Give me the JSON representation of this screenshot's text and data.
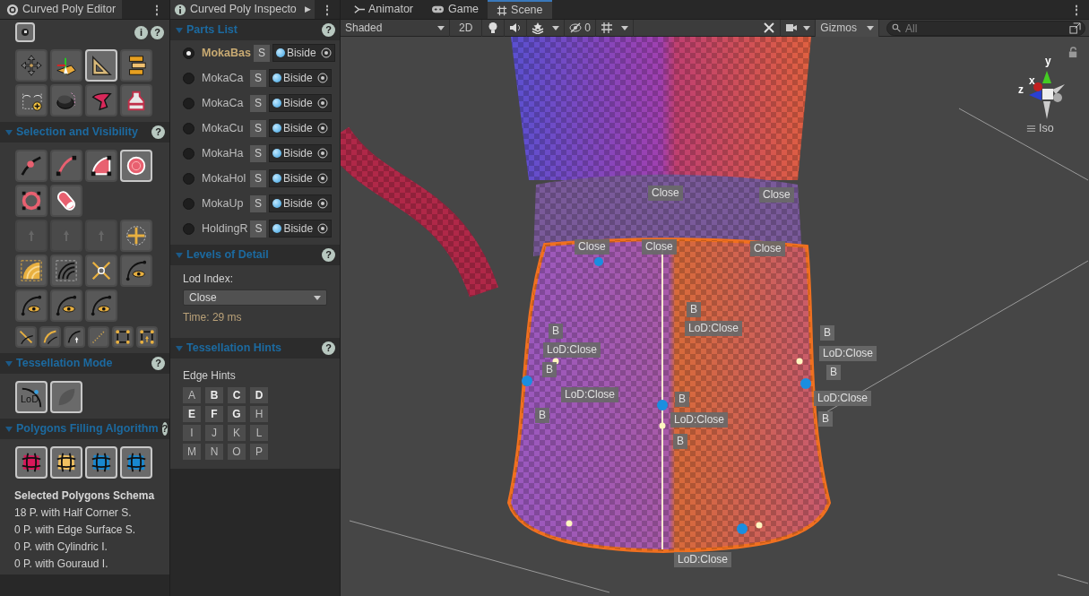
{
  "editor": {
    "title": "Curved Poly Editor",
    "menu": "⋮",
    "info": "i",
    "help": "?",
    "toolbar_rows": [
      [
        {
          "selected": false
        },
        {
          "selected": false
        },
        {
          "selected": true
        },
        {
          "selected": false
        }
      ],
      [
        {
          "selected": false
        },
        {
          "selected": false
        },
        {
          "selected": false
        },
        {
          "selected": false
        }
      ]
    ],
    "sections": [
      {
        "title": "Selection and Visibility",
        "help": "?",
        "expanded": true,
        "rows": [
          {
            "kind": "large",
            "buttons": [
              {
                "selected": false
              },
              {
                "selected": false
              },
              {
                "selected": false
              },
              {
                "selected": true
              }
            ]
          },
          {
            "kind": "large",
            "buttons": [
              {
                "selected": false
              },
              {
                "selected": false
              }
            ]
          },
          {
            "kind": "large",
            "buttons": [
              {
                "selected": false,
                "disabled": true
              },
              {
                "selected": false,
                "disabled": true
              },
              {
                "selected": false,
                "disabled": true
              },
              {
                "selected": false,
                "disabled": false
              }
            ]
          },
          {
            "kind": "large",
            "buttons": [
              {
                "selected": false
              },
              {
                "selected": false
              },
              {
                "selected": false
              },
              {
                "selected": false
              }
            ]
          },
          {
            "kind": "large",
            "buttons": [
              {
                "selected": false
              },
              {
                "selected": false
              },
              {
                "selected": false
              }
            ]
          },
          {
            "kind": "small",
            "buttons": [
              {
                "selected": false
              },
              {
                "selected": false
              },
              {
                "selected": false
              },
              {
                "selected": false
              },
              {
                "selected": false
              },
              {
                "selected": false
              }
            ]
          }
        ]
      },
      {
        "title": "Tessellation Mode",
        "help": "?",
        "expanded": true,
        "rows": [
          {
            "kind": "large",
            "buttons": [
              {
                "selected": true,
                "label": "LoD"
              },
              {
                "selected": true
              }
            ]
          }
        ]
      },
      {
        "title": "Polygons Filling Algorithm",
        "help": "?",
        "expanded": true,
        "rows": [
          {
            "kind": "large",
            "buttons": [
              {
                "selected": true
              },
              {
                "selected": true
              },
              {
                "selected": true
              },
              {
                "selected": true
              }
            ]
          }
        ]
      }
    ],
    "schema": {
      "title": "Selected Polygons Schema",
      "lines": [
        "18 P. with Half Corner S.",
        "0 P. with Edge Surface S.",
        "0 P. with Cylindric I.",
        "0 P. with Gouraud I."
      ]
    }
  },
  "inspector": {
    "title": "Curved Poly Inspecto",
    "more": "▶",
    "menu": "⋮",
    "sections": [
      {
        "kind": "parts",
        "title": "Parts List",
        "help": "?",
        "expanded": true,
        "parts": [
          {
            "name": "MokaBas",
            "selected": true,
            "solo": "S",
            "mode": "Biside"
          },
          {
            "name": "MokaCa",
            "selected": false,
            "solo": "S",
            "mode": "Biside"
          },
          {
            "name": "MokaCa",
            "selected": false,
            "solo": "S",
            "mode": "Biside"
          },
          {
            "name": "MokaCu",
            "selected": false,
            "solo": "S",
            "mode": "Biside"
          },
          {
            "name": "MokaHa",
            "selected": false,
            "solo": "S",
            "mode": "Biside"
          },
          {
            "name": "MokaHol",
            "selected": false,
            "solo": "S",
            "mode": "Biside"
          },
          {
            "name": "MokaUp",
            "selected": false,
            "solo": "S",
            "mode": "Biside"
          },
          {
            "name": "HoldingR",
            "selected": false,
            "solo": "S",
            "mode": "Biside"
          }
        ]
      },
      {
        "kind": "lod",
        "title": "Levels of Detail",
        "help": "?",
        "expanded": true,
        "label": "Lod Index:",
        "value": "Close",
        "time": "Time: 29 ms"
      },
      {
        "kind": "hints",
        "title": "Tessellation Hints",
        "help": "?",
        "expanded": true,
        "label": "Edge Hints",
        "hints": [
          {
            "label": "A",
            "on": false
          },
          {
            "label": "B",
            "on": true
          },
          {
            "label": "C",
            "on": true
          },
          {
            "label": "D",
            "on": true
          },
          {
            "label": "E",
            "on": true
          },
          {
            "label": "F",
            "on": true
          },
          {
            "label": "G",
            "on": true
          },
          {
            "label": "H",
            "on": false
          },
          {
            "label": "I",
            "on": false
          },
          {
            "label": "J",
            "on": false
          },
          {
            "label": "K",
            "on": false
          },
          {
            "label": "L",
            "on": false
          },
          {
            "label": "M",
            "on": false
          },
          {
            "label": "N",
            "on": false
          },
          {
            "label": "O",
            "on": false
          },
          {
            "label": "P",
            "on": false
          }
        ]
      }
    ]
  },
  "scene": {
    "menu": "⋮",
    "tabs": [
      {
        "label": "Animator",
        "selected": false
      },
      {
        "label": "Game",
        "selected": false
      },
      {
        "label": "Scene",
        "selected": true
      }
    ],
    "toolbar": {
      "shading": "Shaded",
      "mode_2d": "2D",
      "hidden_count": "0",
      "gizmos": "Gizmos",
      "search_placeholder": "All"
    },
    "gizmo": {
      "axes": [
        "x",
        "y",
        "z"
      ],
      "projection": "Iso"
    },
    "labels": [
      {
        "text": "Close"
      },
      {
        "text": "Close"
      },
      {
        "text": "Close"
      },
      {
        "text": "Close"
      },
      {
        "text": "Close"
      },
      {
        "text": "B"
      },
      {
        "text": "B"
      },
      {
        "text": "LoD:Close"
      },
      {
        "text": "B"
      },
      {
        "text": "LoD:Close"
      },
      {
        "text": "LoD:Close"
      },
      {
        "text": "B"
      },
      {
        "text": "B"
      },
      {
        "text": "LoD:Close"
      },
      {
        "text": "B"
      },
      {
        "text": "LoD:Close"
      },
      {
        "text": "B"
      },
      {
        "text": "LoD:Close"
      },
      {
        "text": "B"
      },
      {
        "text": "B"
      },
      {
        "text": "LoD:Close"
      }
    ]
  }
}
